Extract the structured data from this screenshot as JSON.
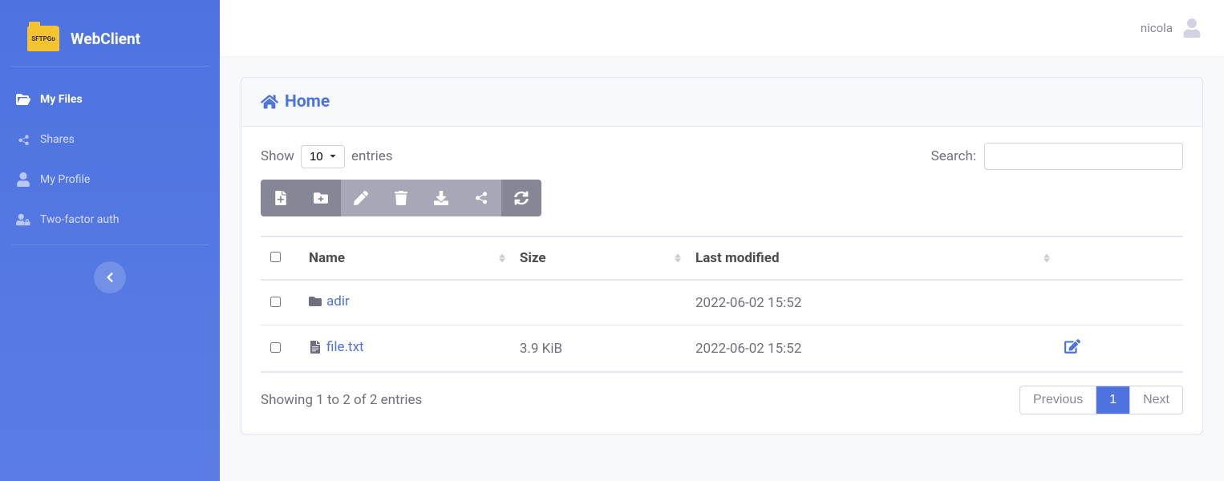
{
  "brand": {
    "logoText": "SFTPGo",
    "title": "WebClient"
  },
  "sidebar": {
    "items": [
      {
        "label": "My Files"
      },
      {
        "label": "Shares"
      },
      {
        "label": "My Profile"
      },
      {
        "label": "Two-factor auth"
      }
    ]
  },
  "topbar": {
    "username": "nicola"
  },
  "breadcrumb": {
    "home": "Home"
  },
  "controls": {
    "showLabel": "Show",
    "entriesLabel": "entries",
    "entriesValue": "10",
    "searchLabel": "Search:"
  },
  "columns": {
    "name": "Name",
    "size": "Size",
    "modified": "Last modified"
  },
  "rows": [
    {
      "name": "adir",
      "size": "",
      "modified": "2022-06-02 15:52",
      "type": "folder",
      "editable": false
    },
    {
      "name": "file.txt",
      "size": "3.9 KiB",
      "modified": "2022-06-02 15:52",
      "type": "file",
      "editable": true
    }
  ],
  "footer": {
    "info": "Showing 1 to 2 of 2 entries",
    "prev": "Previous",
    "page": "1",
    "next": "Next"
  }
}
